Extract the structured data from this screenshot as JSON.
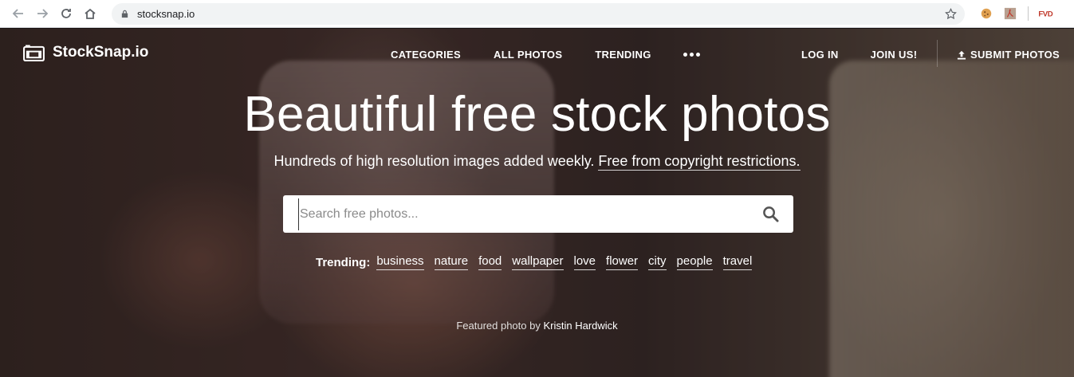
{
  "browser": {
    "url": "stocksnap.io"
  },
  "header": {
    "logo_text": "StockSnap.io",
    "nav": {
      "categories": "CATEGORIES",
      "all_photos": "ALL PHOTOS",
      "trending": "TRENDING"
    },
    "login": "LOG IN",
    "join": "JOIN US!",
    "submit": "SUBMIT PHOTOS"
  },
  "hero": {
    "headline": "Beautiful free stock photos",
    "subline": "Hundreds of high resolution images added weekly.",
    "subline_link": "Free from copyright restrictions.",
    "search_placeholder": "Search free photos...",
    "trending_label": "Trending:",
    "trending_tags": [
      "business",
      "nature",
      "food",
      "wallpaper",
      "love",
      "flower",
      "city",
      "people",
      "travel"
    ],
    "credit_prefix": "Featured photo by",
    "credit_author": "Kristin Hardwick"
  },
  "colors": {
    "text": "#ffffff",
    "search_bg": "#ffffff"
  }
}
